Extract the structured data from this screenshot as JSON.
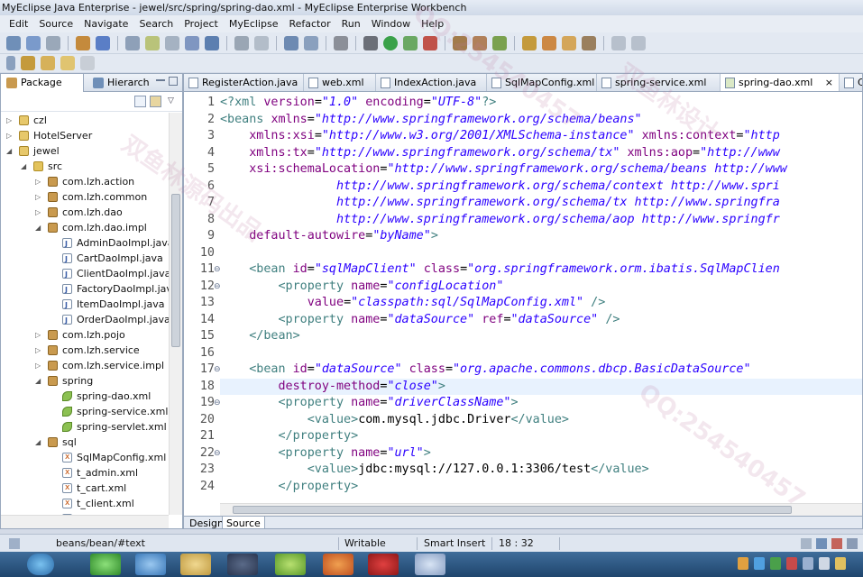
{
  "window": {
    "title": "MyEclipse Java Enterprise - jewel/src/spring/spring-dao.xml - MyEclipse Enterprise Workbench"
  },
  "menu": [
    "Edit",
    "Source",
    "Navigate",
    "Search",
    "Project",
    "MyEclipse",
    "Refactor",
    "Run",
    "Window",
    "Help"
  ],
  "left_panel": {
    "tabs": [
      {
        "label": "Package",
        "active": true
      },
      {
        "label": "Hierarch",
        "active": false
      }
    ],
    "tree": [
      {
        "label": "czl",
        "icon": "project-folder-icon",
        "depth": 0,
        "twist": "▷"
      },
      {
        "label": "HotelServer",
        "icon": "project-folder-icon",
        "depth": 0,
        "twist": "▷"
      },
      {
        "label": "jewel",
        "icon": "project-folder-icon",
        "depth": 0,
        "twist": "◢"
      },
      {
        "label": "src",
        "icon": "source-folder-icon",
        "depth": 1,
        "twist": "◢"
      },
      {
        "label": "com.lzh.action",
        "icon": "package-icon",
        "depth": 2,
        "twist": "▷"
      },
      {
        "label": "com.lzh.common",
        "icon": "package-icon",
        "depth": 2,
        "twist": "▷"
      },
      {
        "label": "com.lzh.dao",
        "icon": "package-icon",
        "depth": 2,
        "twist": "▷"
      },
      {
        "label": "com.lzh.dao.impl",
        "icon": "package-icon",
        "depth": 2,
        "twist": "◢"
      },
      {
        "label": "AdminDaoImpl.java",
        "icon": "java-file-icon",
        "depth": 3,
        "twist": ""
      },
      {
        "label": "CartDaoImpl.java",
        "icon": "java-file-icon",
        "depth": 3,
        "twist": ""
      },
      {
        "label": "ClientDaoImpl.java",
        "icon": "java-file-icon",
        "depth": 3,
        "twist": ""
      },
      {
        "label": "FactoryDaoImpl.java",
        "icon": "java-file-icon",
        "depth": 3,
        "twist": ""
      },
      {
        "label": "ItemDaoImpl.java",
        "icon": "java-file-icon",
        "depth": 3,
        "twist": ""
      },
      {
        "label": "OrderDaoImpl.java",
        "icon": "java-file-icon",
        "depth": 3,
        "twist": ""
      },
      {
        "label": "com.lzh.pojo",
        "icon": "package-icon",
        "depth": 2,
        "twist": "▷"
      },
      {
        "label": "com.lzh.service",
        "icon": "package-icon",
        "depth": 2,
        "twist": "▷"
      },
      {
        "label": "com.lzh.service.impl",
        "icon": "package-icon",
        "depth": 2,
        "twist": "▷"
      },
      {
        "label": "spring",
        "icon": "package-icon",
        "depth": 2,
        "twist": "◢"
      },
      {
        "label": "spring-dao.xml",
        "icon": "spring-leaf-icon",
        "depth": 3,
        "twist": ""
      },
      {
        "label": "spring-service.xml",
        "icon": "spring-leaf-icon",
        "depth": 3,
        "twist": ""
      },
      {
        "label": "spring-servlet.xml",
        "icon": "spring-leaf-icon",
        "depth": 3,
        "twist": ""
      },
      {
        "label": "sql",
        "icon": "package-icon",
        "depth": 2,
        "twist": "◢"
      },
      {
        "label": "SqlMapConfig.xml",
        "icon": "xml-file-icon",
        "depth": 3,
        "twist": ""
      },
      {
        "label": "t_admin.xml",
        "icon": "xml-file-icon",
        "depth": 3,
        "twist": ""
      },
      {
        "label": "t_cart.xml",
        "icon": "xml-file-icon",
        "depth": 3,
        "twist": ""
      },
      {
        "label": "t_client.xml",
        "icon": "xml-file-icon",
        "depth": 3,
        "twist": ""
      },
      {
        "label": "t_factory.xml",
        "icon": "xml-file-icon",
        "depth": 3,
        "twist": ""
      }
    ]
  },
  "editor": {
    "tabs": [
      {
        "label": "RegisterAction.java",
        "active": false
      },
      {
        "label": "web.xml",
        "active": false
      },
      {
        "label": "IndexAction.java",
        "active": false
      },
      {
        "label": "SqlMapConfig.xml",
        "active": false
      },
      {
        "label": "spring-service.xml",
        "active": false
      },
      {
        "label": "spring-dao.xml",
        "active": true,
        "close": "×"
      },
      {
        "label": "C",
        "active": false
      }
    ],
    "current_line": 18,
    "lines": [
      {
        "n": "1",
        "fold": "",
        "segs": [
          [
            "pi",
            "<?"
          ],
          [
            "tag",
            "xml "
          ],
          [
            "attr",
            "version"
          ],
          [
            "txt",
            "="
          ],
          [
            "val",
            "\"1.0\""
          ],
          [
            "txt",
            " "
          ],
          [
            "attr",
            "encoding"
          ],
          [
            "txt",
            "="
          ],
          [
            "val",
            "\"UTF-8\""
          ],
          [
            "pi",
            "?>"
          ]
        ]
      },
      {
        "n": "2",
        "fold": "",
        "segs": [
          [
            "tag",
            "<beans "
          ],
          [
            "attr",
            "xmlns"
          ],
          [
            "txt",
            "="
          ],
          [
            "val",
            "\"http://www.springframework.org/schema/beans\""
          ]
        ]
      },
      {
        "n": "3",
        "fold": "",
        "segs": [
          [
            "txt",
            "    "
          ],
          [
            "attr",
            "xmlns:xsi"
          ],
          [
            "txt",
            "="
          ],
          [
            "val",
            "\"http://www.w3.org/2001/XMLSchema-instance\""
          ],
          [
            "txt",
            " "
          ],
          [
            "attr",
            "xmlns:context"
          ],
          [
            "txt",
            "="
          ],
          [
            "val",
            "\"http"
          ]
        ]
      },
      {
        "n": "4",
        "fold": "",
        "segs": [
          [
            "txt",
            "    "
          ],
          [
            "attr",
            "xmlns:tx"
          ],
          [
            "txt",
            "="
          ],
          [
            "val",
            "\"http://www.springframework.org/schema/tx\""
          ],
          [
            "txt",
            " "
          ],
          [
            "attr",
            "xmlns:aop"
          ],
          [
            "txt",
            "="
          ],
          [
            "val",
            "\"http://www"
          ]
        ]
      },
      {
        "n": "5",
        "fold": "",
        "segs": [
          [
            "txt",
            "    "
          ],
          [
            "attr",
            "xsi:schemaLocation"
          ],
          [
            "txt",
            "="
          ],
          [
            "val",
            "\"http://www.springframework.org/schema/beans http://www"
          ]
        ]
      },
      {
        "n": "6",
        "fold": "",
        "segs": [
          [
            "val",
            "                http://www.springframework.org/schema/context http://www.spri"
          ]
        ]
      },
      {
        "n": "7",
        "fold": "",
        "segs": [
          [
            "val",
            "                http://www.springframework.org/schema/tx http://www.springfra"
          ]
        ]
      },
      {
        "n": "8",
        "fold": "",
        "segs": [
          [
            "val",
            "                http://www.springframework.org/schema/aop http://www.springfr"
          ]
        ]
      },
      {
        "n": "9",
        "fold": "",
        "segs": [
          [
            "txt",
            "    "
          ],
          [
            "attr",
            "default-autowire"
          ],
          [
            "txt",
            "="
          ],
          [
            "val",
            "\"byName\""
          ],
          [
            "tag",
            ">"
          ]
        ]
      },
      {
        "n": "10",
        "fold": "",
        "segs": []
      },
      {
        "n": "11",
        "fold": "⊖",
        "segs": [
          [
            "txt",
            "    "
          ],
          [
            "tag",
            "<bean "
          ],
          [
            "attr",
            "id"
          ],
          [
            "txt",
            "="
          ],
          [
            "val",
            "\"sqlMapClient\""
          ],
          [
            "txt",
            " "
          ],
          [
            "attr",
            "class"
          ],
          [
            "txt",
            "="
          ],
          [
            "val",
            "\"org.springframework.orm.ibatis.SqlMapClien"
          ]
        ]
      },
      {
        "n": "12",
        "fold": "⊖",
        "segs": [
          [
            "txt",
            "        "
          ],
          [
            "tag",
            "<property "
          ],
          [
            "attr",
            "name"
          ],
          [
            "txt",
            "="
          ],
          [
            "val",
            "\"configLocation\""
          ]
        ]
      },
      {
        "n": "13",
        "fold": "",
        "segs": [
          [
            "txt",
            "            "
          ],
          [
            "attr",
            "value"
          ],
          [
            "txt",
            "="
          ],
          [
            "val",
            "\"classpath:sql/SqlMapConfig.xml\""
          ],
          [
            "txt",
            " "
          ],
          [
            "tag",
            "/>"
          ]
        ]
      },
      {
        "n": "14",
        "fold": "",
        "segs": [
          [
            "txt",
            "        "
          ],
          [
            "tag",
            "<property "
          ],
          [
            "attr",
            "name"
          ],
          [
            "txt",
            "="
          ],
          [
            "val",
            "\"dataSource\""
          ],
          [
            "txt",
            " "
          ],
          [
            "attr",
            "ref"
          ],
          [
            "txt",
            "="
          ],
          [
            "val",
            "\"dataSource\""
          ],
          [
            "txt",
            " "
          ],
          [
            "tag",
            "/>"
          ]
        ]
      },
      {
        "n": "15",
        "fold": "",
        "segs": [
          [
            "txt",
            "    "
          ],
          [
            "tag",
            "</bean>"
          ]
        ]
      },
      {
        "n": "16",
        "fold": "",
        "segs": []
      },
      {
        "n": "17",
        "fold": "⊖",
        "segs": [
          [
            "txt",
            "    "
          ],
          [
            "tag",
            "<bean "
          ],
          [
            "attr",
            "id"
          ],
          [
            "txt",
            "="
          ],
          [
            "val",
            "\"dataSource\""
          ],
          [
            "txt",
            " "
          ],
          [
            "attr",
            "class"
          ],
          [
            "txt",
            "="
          ],
          [
            "val",
            "\"org.apache.commons.dbcp.BasicDataSource\""
          ]
        ]
      },
      {
        "n": "18",
        "fold": "",
        "segs": [
          [
            "txt",
            "        "
          ],
          [
            "attr",
            "destroy-method"
          ],
          [
            "txt",
            "="
          ],
          [
            "val",
            "\"close\""
          ],
          [
            "tag",
            ">"
          ]
        ]
      },
      {
        "n": "19",
        "fold": "⊖",
        "segs": [
          [
            "txt",
            "        "
          ],
          [
            "tag",
            "<property "
          ],
          [
            "attr",
            "name"
          ],
          [
            "txt",
            "="
          ],
          [
            "val",
            "\"driverClassName\""
          ],
          [
            "tag",
            ">"
          ]
        ]
      },
      {
        "n": "20",
        "fold": "",
        "segs": [
          [
            "txt",
            "            "
          ],
          [
            "tag",
            "<value>"
          ],
          [
            "txt",
            "com.mysql.jdbc.Driver"
          ],
          [
            "tag",
            "</value>"
          ]
        ]
      },
      {
        "n": "21",
        "fold": "",
        "segs": [
          [
            "txt",
            "        "
          ],
          [
            "tag",
            "</property>"
          ]
        ]
      },
      {
        "n": "22",
        "fold": "⊖",
        "segs": [
          [
            "txt",
            "        "
          ],
          [
            "tag",
            "<property "
          ],
          [
            "attr",
            "name"
          ],
          [
            "txt",
            "="
          ],
          [
            "val",
            "\"url\""
          ],
          [
            "tag",
            ">"
          ]
        ]
      },
      {
        "n": "23",
        "fold": "",
        "segs": [
          [
            "txt",
            "            "
          ],
          [
            "tag",
            "<value>"
          ],
          [
            "txt",
            "jdbc:mysql://127.0.0.1:3306/test"
          ],
          [
            "tag",
            "</value>"
          ]
        ]
      },
      {
        "n": "24",
        "fold": "",
        "segs": [
          [
            "txt",
            "        "
          ],
          [
            "tag",
            "</property>"
          ]
        ]
      }
    ],
    "bottom_tabs": [
      {
        "label": "Design",
        "active": false
      },
      {
        "label": "Source",
        "active": true
      }
    ]
  },
  "status": {
    "path": "beans/bean/#text",
    "mode": "Writable",
    "insert": "Smart Insert",
    "position": "18 : 32"
  },
  "watermarks": [
    "双鱼林源码出品",
    "QQ:254540457",
    "双鱼林设计",
    "QQ:254540457"
  ],
  "colors": {
    "tag": "#3f7f7f",
    "attr": "#7f007f",
    "value": "#2a00ff",
    "current_line": "#e8f2fe"
  }
}
